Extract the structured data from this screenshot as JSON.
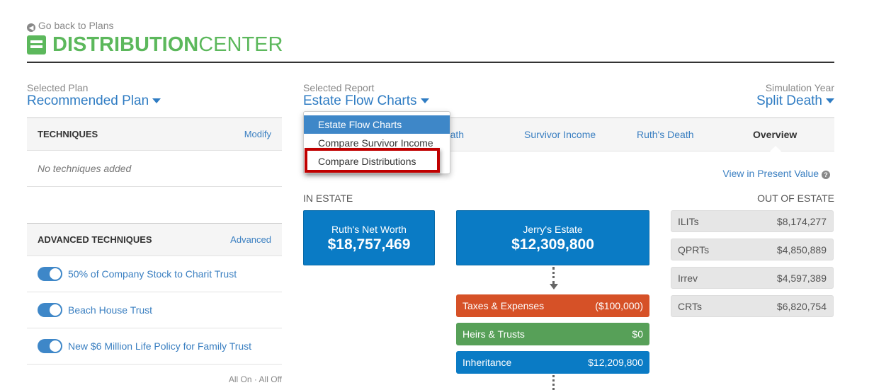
{
  "header": {
    "back_link": "Go back to Plans",
    "title_bold": "DISTRIBUTION",
    "title_light": "CENTER",
    "brand_color": "#5cb85c"
  },
  "selectors": {
    "plan": {
      "label": "Selected Plan",
      "value": "Recommended Plan"
    },
    "report": {
      "label": "Selected Report",
      "value": "Estate Flow Charts",
      "options": [
        "Estate Flow Charts",
        "Compare Survivor Income",
        "Compare Distributions"
      ],
      "highlighted": "Compare Distributions"
    },
    "year": {
      "label": "Simulation Year",
      "value": "Split Death"
    }
  },
  "techniques": {
    "title": "TECHNIQUES",
    "action": "Modify",
    "empty": "No techniques added"
  },
  "advanced": {
    "title": "ADVANCED TECHNIQUES",
    "action": "Advanced",
    "items": [
      {
        "label": "50% of Company Stock to Charit Trust",
        "on": true
      },
      {
        "label": "Beach House Trust",
        "on": true
      },
      {
        "label": "New $6 Million Life Policy for Family Trust",
        "on": true
      }
    ],
    "all_on": "All On",
    "sep": "·",
    "all_off": "All Off"
  },
  "tabs": [
    {
      "label": "Jerry's Death"
    },
    {
      "label": "Survivor Income"
    },
    {
      "label": "Ruth's Death"
    },
    {
      "label": "Overview",
      "active": true
    }
  ],
  "view_present": "View in Present Value",
  "in_estate": "IN ESTATE",
  "out_estate": "OUT OF ESTATE",
  "estate": {
    "ruth": {
      "title": "Ruth's Net Worth",
      "value": "$18,757,469"
    },
    "jerry": {
      "title": "Jerry's Estate",
      "value": "$12,309,800"
    },
    "flows": [
      {
        "label": "Taxes & Expenses",
        "value": "($100,000)",
        "color": "#d65127"
      },
      {
        "label": "Heirs & Trusts",
        "value": "$0",
        "color": "#57a058"
      },
      {
        "label": "Inheritance",
        "value": "$12,209,800",
        "color": "#0a7bc5"
      }
    ]
  },
  "out": [
    {
      "label": "ILITs",
      "value": "$8,174,277"
    },
    {
      "label": "QPRTs",
      "value": "$4,850,889"
    },
    {
      "label": "Irrev",
      "value": "$4,597,389"
    },
    {
      "label": "CRTs",
      "value": "$6,820,754"
    }
  ]
}
